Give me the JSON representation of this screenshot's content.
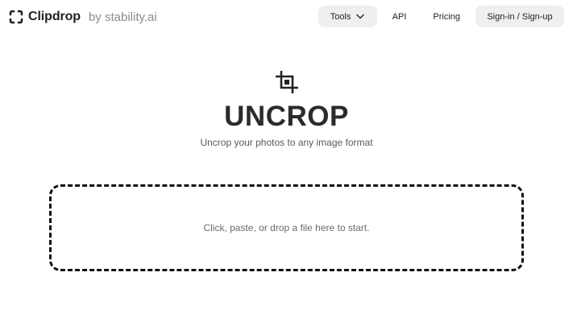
{
  "brand": {
    "name": "Clipdrop",
    "byline": "by stability.ai",
    "icon": "clipdrop-logo-icon"
  },
  "nav": {
    "tools_label": "Tools",
    "api_label": "API",
    "pricing_label": "Pricing",
    "signin_label": "Sign-in / Sign-up"
  },
  "hero": {
    "icon": "crop-icon",
    "title": "UNCROP",
    "subtitle": "Uncrop your photos to any image format"
  },
  "dropzone": {
    "text": "Click, paste, or drop a file here to start."
  },
  "colors": {
    "background": "#ffffff",
    "pill": "#efefef",
    "text": "#222222",
    "muted": "#6b6b6b"
  }
}
